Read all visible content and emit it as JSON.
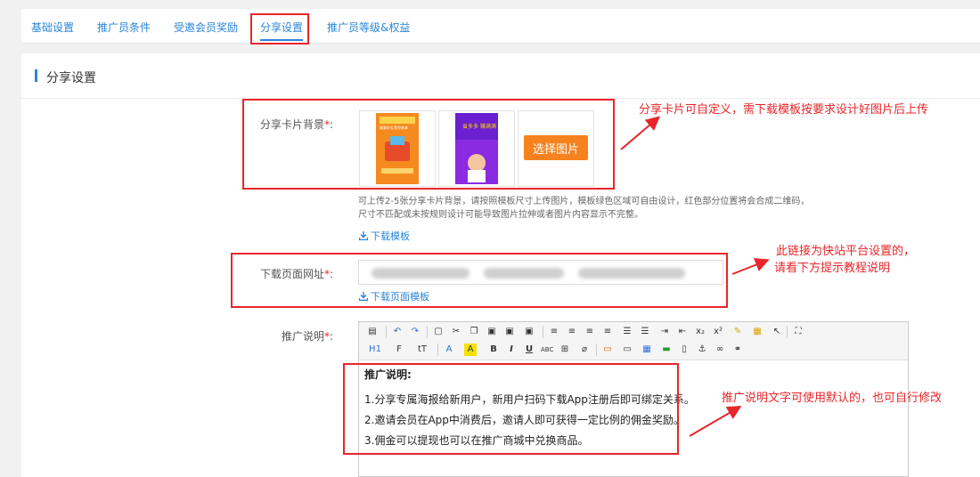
{
  "tabs": [
    {
      "label": "基础设置"
    },
    {
      "label": "推广员条件"
    },
    {
      "label": "受邀会员奖励"
    },
    {
      "label": "分享设置"
    },
    {
      "label": "推广员等级&权益"
    }
  ],
  "section": {
    "title": "分享设置"
  },
  "card_bg": {
    "label": "分享卡片背景",
    "required_mark": "*",
    "colon": ":",
    "choose_button": "选择图片",
    "thumb1_text": "精美好礼等你来拿",
    "thumb2_text": "省多多 赚满满",
    "hint_line1": "可上传2-5张分享卡片背景，请按照模板尺寸上传图片，模板绿色区域可自由设计，红色部分位置将会合成二维码，",
    "hint_line2": "尺寸不匹配或未按规则设计可能导致图片拉伸或者图片内容显示不完整。",
    "download_template": "下载模板"
  },
  "download_url": {
    "label": "下载页面网址",
    "required_mark": "*",
    "colon": ":",
    "download_page_template": "下载页面模板"
  },
  "promo": {
    "label": "推广说明",
    "required_mark": "*",
    "colon": ":",
    "heading": "推广说明:",
    "lines": [
      "1.分享专属海报给新用户，新用户扫码下载App注册后即可绑定关系。",
      "2.邀请会员在App中消费后，邀请人即可获得一定比例的佣金奖励。",
      "3.佣金可以提现也可以在推广商城中兑换商品。"
    ]
  },
  "annotations": {
    "card_note": "分享卡片可自定义，需下载模板按要求设计好图片后上传",
    "url_note_1": "此链接为快站平台设置的，",
    "url_note_2": "请看下方提示教程说明",
    "promo_note": "推广说明文字可使用默认的，也可自行修改"
  },
  "colors": {
    "accent": "#2a85d8",
    "annotation": "#e8262b",
    "button": "#f5821f"
  }
}
